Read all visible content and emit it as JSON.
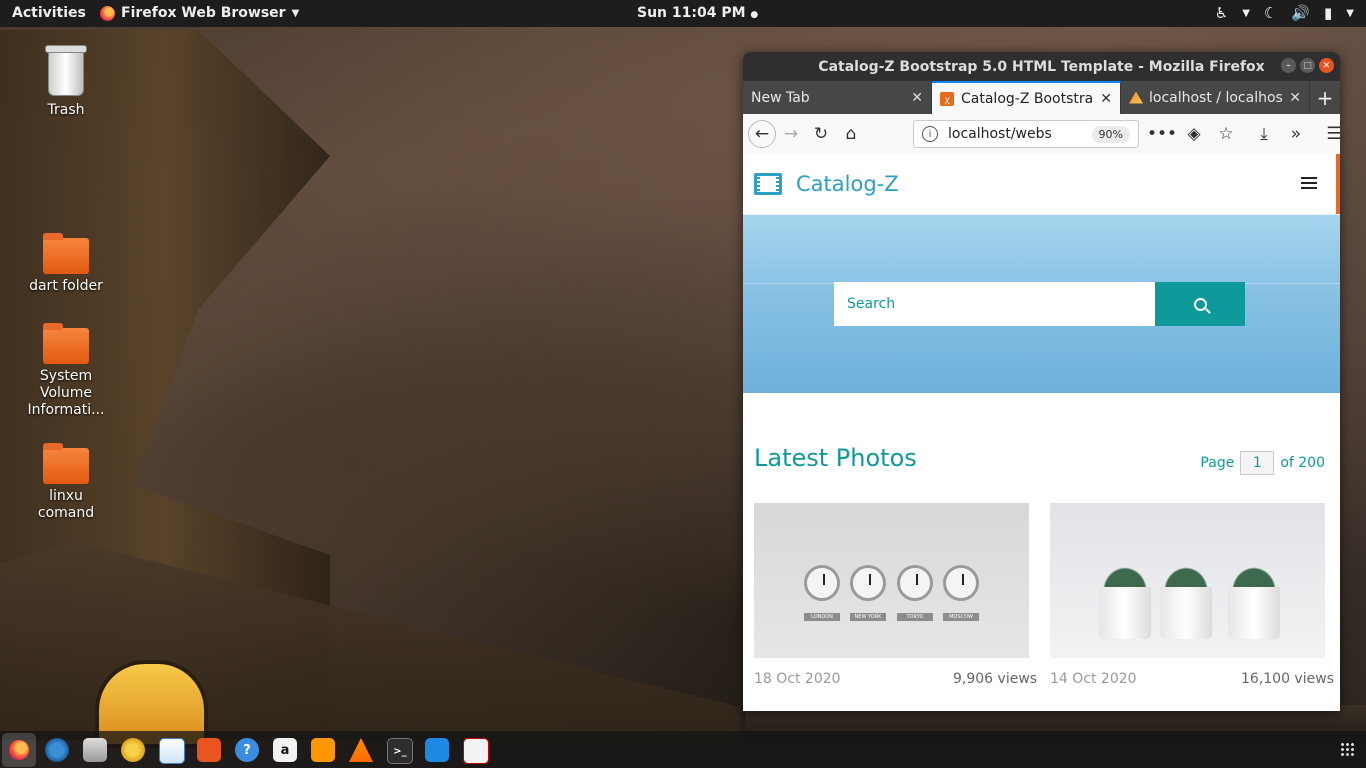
{
  "topbar": {
    "activities": "Activities",
    "app_name": "Firefox Web Browser",
    "clock": "Sun 11:04 PM"
  },
  "desktop": {
    "icons": [
      {
        "label": "Trash",
        "type": "trash"
      },
      {
        "label": "dart folder",
        "type": "folder"
      },
      {
        "label": "System Volume Informati...",
        "type": "folder"
      },
      {
        "label": "linxu comand",
        "type": "folder"
      }
    ]
  },
  "dock": {
    "items": [
      "firefox-icon",
      "thunderbird-icon",
      "files-icon",
      "rhythmbox-icon",
      "libreoffice-writer-icon",
      "software-center-icon",
      "help-icon",
      "amazon-icon",
      "sublime-text-icon",
      "vlc-icon",
      "terminal-icon",
      "vscode-icon",
      "screenshot-icon"
    ],
    "amazon_glyph": "a",
    "help_glyph": "?"
  },
  "window": {
    "title": "Catalog-Z Bootstrap 5.0 HTML Template - Mozilla Firefox",
    "tabs": [
      {
        "title": "New Tab",
        "selected": false
      },
      {
        "title": "Catalog-Z Bootstra",
        "selected": true
      },
      {
        "title": "localhost / localhos",
        "selected": false
      }
    ],
    "url": "localhost/webs",
    "zoom": "90%"
  },
  "site": {
    "brand": "Catalog-Z",
    "search_placeholder": "Search",
    "section_title": "Latest Photos",
    "pager": {
      "prefix": "Page",
      "current": "1",
      "suffix": "of 200"
    },
    "photos": [
      {
        "date": "18 Oct 2020",
        "views": "9,906 views",
        "clock_labels": [
          "LONDON",
          "NEW YORK",
          "TOKYO",
          "MOSCOW"
        ]
      },
      {
        "date": "14 Oct 2020",
        "views": "16,100 views"
      }
    ]
  },
  "colors": {
    "accent_teal": "#0e9a9a",
    "brand_blue": "#2b9fc6",
    "ubuntu_orange": "#e95420"
  }
}
